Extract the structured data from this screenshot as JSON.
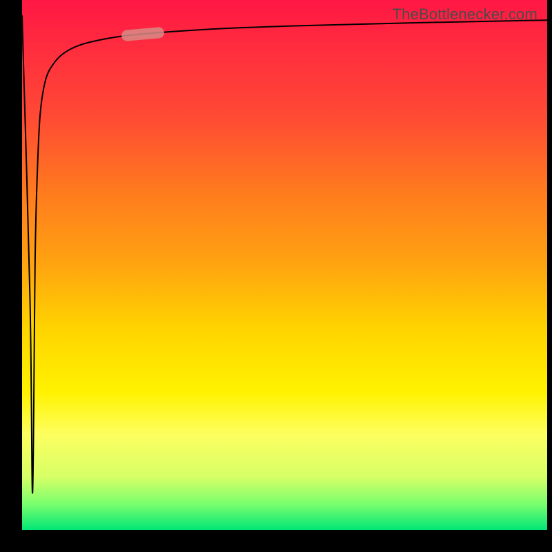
{
  "watermark": {
    "text": "TheBottlenecker.com"
  },
  "colors": {
    "frame": "#000000",
    "curve": "#000000",
    "highlight": "#d88b86",
    "gradient_top": "#ff1744",
    "gradient_bottom": "#00e676"
  },
  "chart_data": {
    "type": "line",
    "title": "",
    "xlabel": "",
    "ylabel": "",
    "xlim": [
      0,
      100
    ],
    "ylim": [
      0,
      100
    ],
    "series": [
      {
        "name": "bottleneck-curve",
        "x": [
          0,
          1.5,
          2.0,
          2.5,
          3.0,
          3.5,
          4.5,
          6.0,
          8.0,
          11,
          15,
          20,
          28,
          40,
          55,
          75,
          100
        ],
        "y": [
          97,
          44,
          7,
          52,
          70,
          79,
          85,
          88,
          90,
          91.5,
          92.5,
          93.3,
          94.0,
          94.7,
          95.2,
          95.7,
          96.2
        ]
      }
    ],
    "annotations": [
      {
        "name": "highlight-segment",
        "x_range": [
          20,
          26
        ],
        "note": "thick rosy stroke on curve"
      }
    ],
    "background": "vertical red→yellow→green gradient"
  }
}
